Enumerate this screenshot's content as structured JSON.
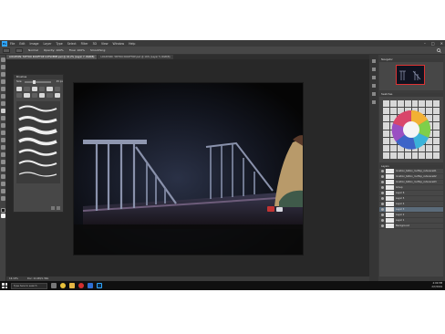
{
  "app": {
    "logo_text": "Ps",
    "menu": [
      "File",
      "Edit",
      "Image",
      "Layer",
      "Type",
      "Select",
      "Filter",
      "3D",
      "View",
      "Window",
      "Help"
    ],
    "window_controls": [
      "–",
      "□",
      "✕"
    ],
    "search_icon": "search-icon"
  },
  "options": {
    "mode_label": "Normal",
    "opacity_label": "Opacity: 100%",
    "flow_label": "Flow: 100%",
    "smoothing_label": "Smoothing:"
  },
  "tabs": [
    "LOCATION: TATTOO ROOFTOP CUTSCENE.psd @ 16.2% (Layer 7, RGB/8)",
    "LOCATION: TATTOO ROOFTOP psd @ 16% (Layer 5, RGB/8)"
  ],
  "brushes_panel": {
    "title": "Brushes",
    "size_label": "Size:",
    "size_value": "45 px"
  },
  "navigator": {
    "title": "Navigator"
  },
  "color_panel": {
    "title": "Swatches"
  },
  "layers_panel": {
    "title": "Layers",
    "rows": [
      {
        "name": "location_tattoo_rooftop_cutscene01",
        "selected": false
      },
      {
        "name": "location_tattoo_rooftop_cutscene02",
        "selected": false
      },
      {
        "name": "location_tattoo_rooftop_cutscene03",
        "selected": false
      },
      {
        "name": "Group",
        "selected": false
      },
      {
        "name": "Layer 6",
        "selected": false
      },
      {
        "name": "Layer 5",
        "selected": false
      },
      {
        "name": "Layer 4",
        "selected": false
      },
      {
        "name": "Layer 3",
        "selected": true
      },
      {
        "name": "Layer 2",
        "selected": false
      },
      {
        "name": "Layer 1",
        "selected": false
      },
      {
        "name": "Background",
        "selected": false
      }
    ]
  },
  "statusbar": {
    "zoom": "16.19%",
    "doc": "Doc: 24.9M/1.39G"
  },
  "taskbar": {
    "search_placeholder": "Type here to search",
    "time": "4:09 PM",
    "date": "2/7/2019"
  }
}
